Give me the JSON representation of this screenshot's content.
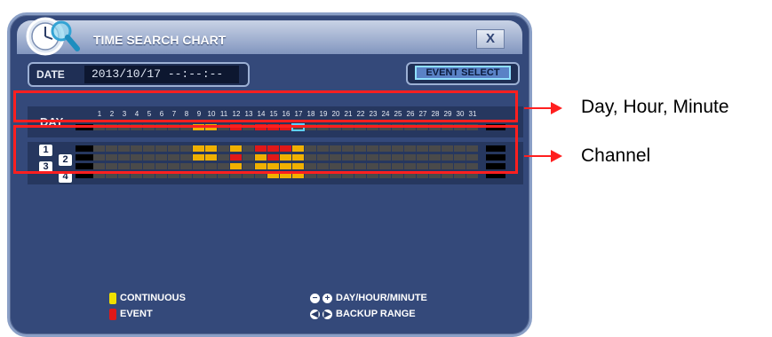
{
  "window": {
    "title": "TIME SEARCH CHART",
    "close_label": "X"
  },
  "date": {
    "label": "DATE",
    "value": "2013/10/17 --:--:--"
  },
  "event_select": {
    "label": "EVENT SELECT"
  },
  "day_row": {
    "label": "DAY",
    "days": [
      "1",
      "2",
      "3",
      "4",
      "5",
      "6",
      "7",
      "8",
      "9",
      "10",
      "11",
      "12",
      "13",
      "14",
      "15",
      "16",
      "17",
      "18",
      "19",
      "20",
      "21",
      "22",
      "23",
      "24",
      "25",
      "26",
      "27",
      "28",
      "29",
      "30",
      "31"
    ],
    "cells": [
      "g",
      "g",
      "g",
      "g",
      "g",
      "g",
      "g",
      "g",
      "y",
      "y",
      "g",
      "r",
      "g",
      "r",
      "r",
      "r",
      "s",
      "g",
      "g",
      "g",
      "g",
      "g",
      "g",
      "g",
      "g",
      "g",
      "g",
      "g",
      "g",
      "g",
      "g"
    ],
    "selected_day": "17"
  },
  "channels": [
    {
      "label": "1",
      "cells": [
        "g",
        "g",
        "g",
        "g",
        "g",
        "g",
        "g",
        "g",
        "y",
        "y",
        "g",
        "y",
        "g",
        "r",
        "r",
        "r",
        "y",
        "g",
        "g",
        "g",
        "g",
        "g",
        "g",
        "g",
        "g",
        "g",
        "g",
        "g",
        "g",
        "g",
        "g"
      ]
    },
    {
      "label": "2",
      "cells": [
        "g",
        "g",
        "g",
        "g",
        "g",
        "g",
        "g",
        "g",
        "y",
        "y",
        "g",
        "r",
        "g",
        "y",
        "r",
        "y",
        "y",
        "g",
        "g",
        "g",
        "g",
        "g",
        "g",
        "g",
        "g",
        "g",
        "g",
        "g",
        "g",
        "g",
        "g"
      ]
    },
    {
      "label": "3",
      "cells": [
        "g",
        "g",
        "g",
        "g",
        "g",
        "g",
        "g",
        "g",
        "g",
        "g",
        "g",
        "y",
        "g",
        "y",
        "y",
        "y",
        "y",
        "g",
        "g",
        "g",
        "g",
        "g",
        "g",
        "g",
        "g",
        "g",
        "g",
        "g",
        "g",
        "g",
        "g"
      ]
    },
    {
      "label": "4",
      "cells": [
        "g",
        "g",
        "g",
        "g",
        "g",
        "g",
        "g",
        "g",
        "g",
        "g",
        "g",
        "g",
        "g",
        "g",
        "y",
        "y",
        "y",
        "g",
        "g",
        "g",
        "g",
        "g",
        "g",
        "g",
        "g",
        "g",
        "g",
        "g",
        "g",
        "g",
        "g"
      ]
    }
  ],
  "legend": {
    "continuous": {
      "label": "CONTINUOUS",
      "color": "#f0e000"
    },
    "event": {
      "label": "EVENT",
      "color": "#e01818"
    },
    "day_hour_minute": {
      "label": "DAY/HOUR/MINUTE",
      "icons": [
        "minus-icon",
        "plus-icon"
      ]
    },
    "backup_range": {
      "label": "BACKUP RANGE",
      "icons": [
        "left-bracket-icon",
        "right-bracket-icon"
      ]
    }
  },
  "annotations": {
    "day_hour_minute": "Day, Hour, Minute",
    "channel": "Channel"
  },
  "colors": {
    "recorded_continuous": "#f0b000",
    "recorded_event": "#e01818",
    "no_record": "#4a4a4a",
    "highlight": "#ff1f1f"
  }
}
